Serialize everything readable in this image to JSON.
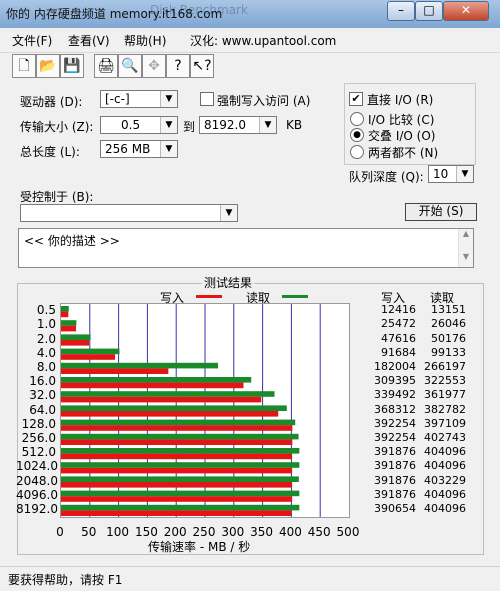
{
  "window": {
    "title_prefix": "你的",
    "title_main": "内存硬盘频道",
    "title_url": "memory.it168.com",
    "title_ghost": "Disk Benchmark"
  },
  "menu": {
    "file": "文件(F)",
    "view": "查看(V)",
    "help": "帮助(H)",
    "localized": "汉化: www.upantool.com"
  },
  "toolbar": {
    "icons": [
      "new-icon",
      "open-icon",
      "save-icon",
      "print-icon",
      "print-preview-icon",
      "move-icon",
      "help-icon",
      "context-help-icon"
    ]
  },
  "settings": {
    "drive_label": "驱动器 (D):",
    "drive_value": "[-c-]",
    "force_write_label": "强制写入访问 (A)",
    "transfer_label": "传输大小 (Z):",
    "transfer_from": "0.5",
    "to_label": "到",
    "transfer_to": "8192.0",
    "unit": "KB",
    "total_label": "总长度 (L):",
    "total_value": "256 MB",
    "direct_io_label": "直接 I/O (R)",
    "io_compare_label": "I/O 比较 (C)",
    "overlapped_io_label": "交叠 I/O (O)",
    "neither_label": "两者都不 (N)",
    "queue_label": "队列深度 (Q):",
    "queue_value": "10",
    "controlled_label": "受控制于 (B):",
    "start_label": "开始 (S)"
  },
  "description": {
    "text": "<<  你的描述   >>"
  },
  "colors": {
    "write": "#e41515",
    "read": "#1a8a2a",
    "grid": "#3333aa"
  },
  "chart_data": {
    "type": "bar",
    "title": "测试结果",
    "legend_write": "写入",
    "legend_read": "读取",
    "xlabel": "传输速率 - MB / 秒",
    "xlim": [
      0,
      500
    ],
    "xticks": [
      0,
      50,
      100,
      150,
      200,
      250,
      300,
      350,
      400,
      450,
      500
    ],
    "categories": [
      "0.5",
      "1.0",
      "2.0",
      "4.0",
      "8.0",
      "16.0",
      "32.0",
      "64.0",
      "128.0",
      "256.0",
      "512.0",
      "1024.0",
      "2048.0",
      "4096.0",
      "8192.0"
    ],
    "write_header": "写入",
    "read_header": "读取",
    "series": [
      {
        "name": "写入",
        "values": [
          12416,
          25472,
          47616,
          91684,
          182004,
          309395,
          339492,
          368312,
          392254,
          392254,
          391876,
          391876,
          391876,
          391876,
          390654
        ]
      },
      {
        "name": "读取",
        "values": [
          13151,
          26046,
          50176,
          99133,
          266197,
          322553,
          361977,
          382782,
          397109,
          402743,
          404096,
          404096,
          403229,
          404096,
          404096
        ]
      }
    ]
  },
  "status": {
    "text": "要获得帮助，请按 F1"
  }
}
